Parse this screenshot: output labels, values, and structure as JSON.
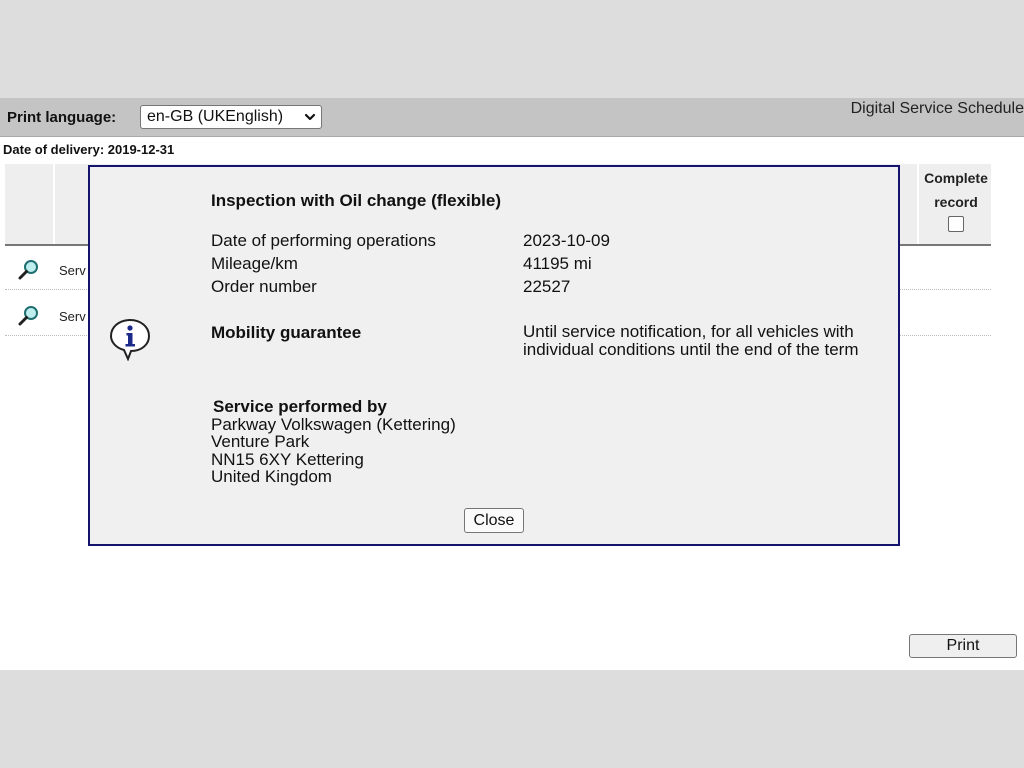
{
  "toolbar": {
    "print_language_label": "Print language:",
    "language_selected": "en-GB (UKEnglish)",
    "app_title": "Digital Service Schedule"
  },
  "delivery": {
    "text": "Date of delivery: 2019-12-31"
  },
  "table": {
    "complete_record_header_line1": "Complete",
    "complete_record_header_line2": "record",
    "rows": [
      {
        "text": "Serv",
        "icon": "magnifier-icon"
      },
      {
        "text": "Serv",
        "icon": "magnifier-icon"
      }
    ]
  },
  "dialog": {
    "icon": "info-icon",
    "title": "Inspection with Oil change (flexible)",
    "fields": [
      {
        "label": "Date of performing operations",
        "value": "2023-10-09"
      },
      {
        "label": "Mileage/km",
        "value": "41195 mi"
      },
      {
        "label": "Order number",
        "value": "22527"
      }
    ],
    "mobility_label": "Mobility guarantee",
    "mobility_value": "Until service notification, for all vehicles with individual conditions until the end of the term",
    "service_performed_by": {
      "title": "Service performed by",
      "lines": [
        "Parkway Volkswagen (Kettering)",
        "Venture Park",
        "NN15 6XY Kettering",
        "United Kingdom"
      ]
    },
    "close_label": "Close"
  },
  "footer": {
    "print_label": "Print"
  },
  "colors": {
    "dialog_border": "#14146e",
    "toolbar_bg": "#c4c4c4",
    "dialog_bg": "#f0f0f0"
  }
}
